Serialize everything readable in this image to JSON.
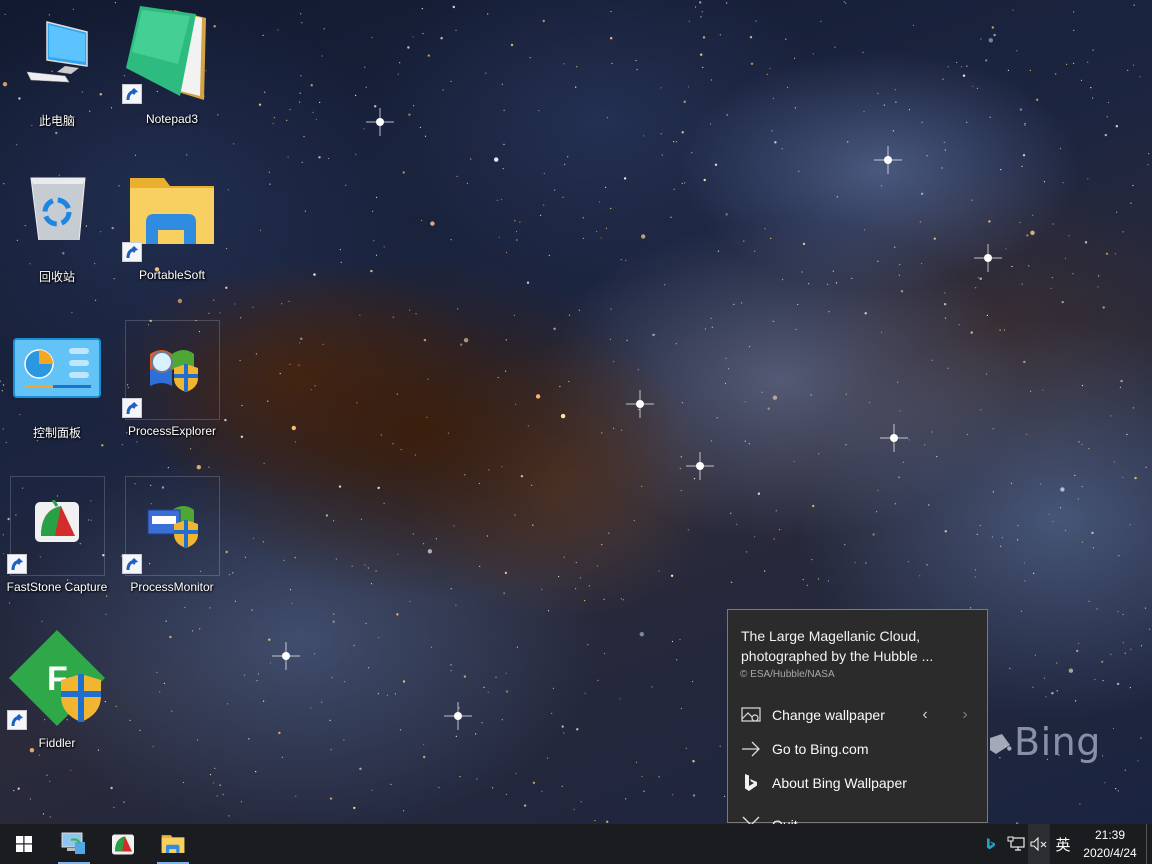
{
  "desktop": {
    "icons": [
      {
        "name": "此电脑",
        "icon": "this-pc-icon",
        "shortcut": false
      },
      {
        "name": "Notepad3",
        "icon": "notepad3-icon",
        "shortcut": true
      },
      {
        "name": "回收站",
        "icon": "recycle-bin-icon",
        "shortcut": false
      },
      {
        "name": "PortableSoft",
        "icon": "folder-icon",
        "shortcut": true
      },
      {
        "name": "控制面板",
        "icon": "control-panel-icon",
        "shortcut": false
      },
      {
        "name": "ProcessExplorer",
        "icon": "process-explorer-icon",
        "shortcut": true
      },
      {
        "name": "FastStone Capture",
        "icon": "faststone-capture-icon",
        "shortcut": true
      },
      {
        "name": "ProcessMonitor",
        "icon": "process-monitor-icon",
        "shortcut": true
      },
      {
        "name": "Fiddler",
        "icon": "fiddler-icon",
        "shortcut": true
      }
    ],
    "watermark": "Bing"
  },
  "bing_menu": {
    "title": "The Large Magellanic Cloud, photographed by the Hubble ...",
    "copyright": "© ESA/Hubble/NASA",
    "items": [
      {
        "label": "Change wallpaper",
        "icon": "change-wallpaper-icon"
      },
      {
        "label": "Go to Bing.com",
        "icon": "arrow-right-icon"
      },
      {
        "label": "About Bing Wallpaper",
        "icon": "bing-logo-icon"
      },
      {
        "label": "Quit",
        "icon": "close-icon"
      }
    ],
    "prev_glyph": "‹",
    "next_glyph": "›"
  },
  "taskbar": {
    "start": "start-button",
    "pinned": [
      {
        "name": "remote-desktop",
        "active": true
      },
      {
        "name": "faststone-capture",
        "active": false
      },
      {
        "name": "file-explorer",
        "active": true
      }
    ],
    "tray": {
      "bing_icon": "bing-tray-icon",
      "network_icon": "network-icon",
      "volume_icon": "volume-muted-icon",
      "ime_label": "英"
    },
    "clock": {
      "time": "21:39",
      "date": "2020/4/24"
    }
  },
  "colors": {
    "menu_bg": "#2b2b2b",
    "taskbar_bg": "#1b1c1f",
    "accent": "#7fb4e6",
    "bing_tray": "#1fa0c8"
  }
}
